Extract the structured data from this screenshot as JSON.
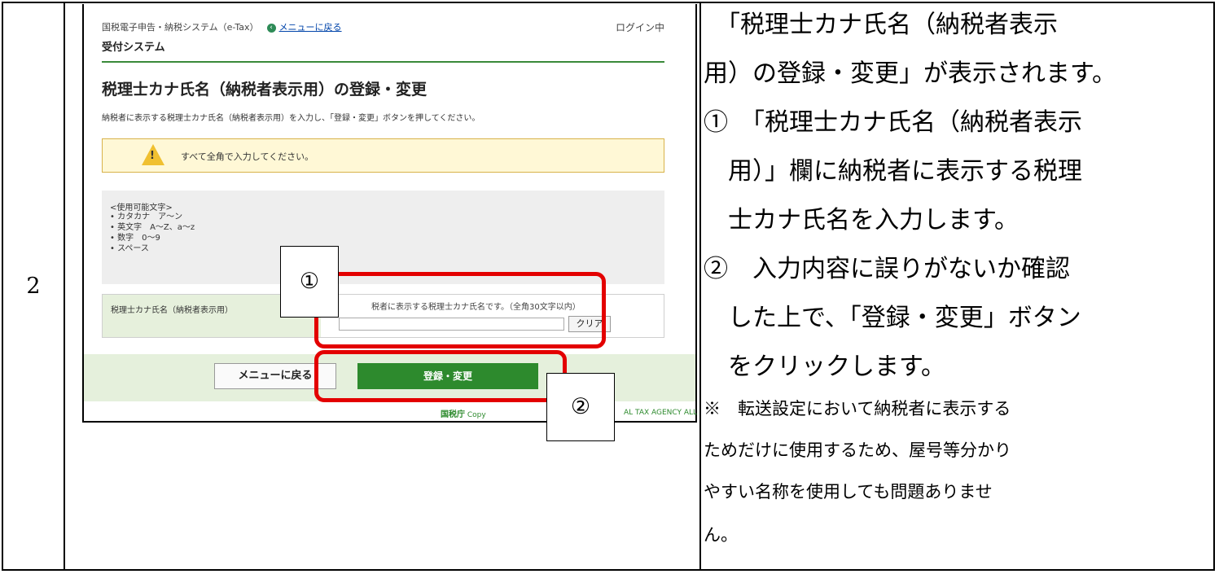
{
  "step_number": "2",
  "screenshot": {
    "header_system": "国税電子申告・納税システム（e-Tax）",
    "menu_link": "メニューに戻る",
    "login_status": "ログイン中",
    "system_name": "受付システム",
    "page_title": "税理士カナ氏名（納税者表示用）の登録・変更",
    "instruction": "納税者に表示する税理士カナ氏名（納税者表示用）を入力し、「登録・変更」ボタンを押してください。",
    "warning": "すべて全角で入力してください。",
    "allowed_chars_heading": "<使用可能文字>",
    "allowed_chars": [
      "カタカナ　ア〜ン",
      "英文字　A〜Z、a〜z",
      "数字　0〜9",
      "スペース"
    ],
    "field_label": "税理士カナ氏名（納税者表示用）",
    "field_hint": "税者に表示する税理士カナ氏名です。（全角30文字以内）",
    "clear_button": "クリア",
    "menu_button": "メニューに戻る",
    "register_button": "登録・変更",
    "footer_logo": "国税庁",
    "footer_copy_left": "Copy",
    "footer_copy_right": "AL TAX AGENCY ALL"
  },
  "callouts": {
    "one": "①",
    "two": "②"
  },
  "description": {
    "lines": [
      "　「税理士カナ氏名（納税者表示",
      "用）の登録・変更」が表示されます。",
      "①　「税理士カナ氏名（納税者表示",
      "　用）」欄に納税者に表示する税理",
      "　士カナ氏名を入力します。",
      "②　入力内容に誤りがないか確認",
      "　した上で、「登録・変更」ボタン",
      "　をクリックします。"
    ],
    "note_lines": [
      "※　転送設定において納税者に表示する",
      "ためだけに使用するため、屋号等分かり",
      "やすい名称を使用しても問題ありませ",
      "ん。"
    ]
  }
}
